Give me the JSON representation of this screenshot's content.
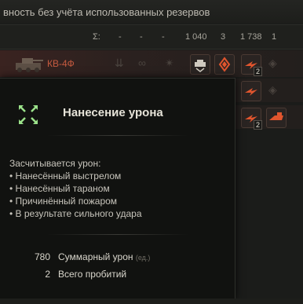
{
  "header": {
    "caption": "вность без учёта использованных резервов"
  },
  "summary": {
    "sigma": "Σ:",
    "cells": [
      "-",
      "-",
      "-",
      "1 040",
      "3",
      "1 738",
      "1"
    ]
  },
  "vehicle": {
    "name": "КВ-4Ф",
    "achievement_count_1": "2",
    "achievement_count_2": "2"
  },
  "tooltip": {
    "title": "Нанесение урона",
    "intro": "Засчитывается урон:",
    "items": [
      "Нанесённый выстрелом",
      "Нанесённый тараном",
      "Причинённый пожаром",
      "В результате сильного удара"
    ],
    "stats": [
      {
        "value": "780",
        "label": "Суммарный урон",
        "unit": "(ед.)"
      },
      {
        "value": "2",
        "label": "Всего пробитий",
        "unit": ""
      }
    ]
  },
  "colors": {
    "accent_red": "#c55a3f",
    "icon_green": "#9be28a",
    "background": "#1b1c1a"
  },
  "icons": [
    "crosshair-expand-icon",
    "tank-thumbnail",
    "tank-gun-icon",
    "fire-icon",
    "impact-icon",
    "ram-icon"
  ]
}
